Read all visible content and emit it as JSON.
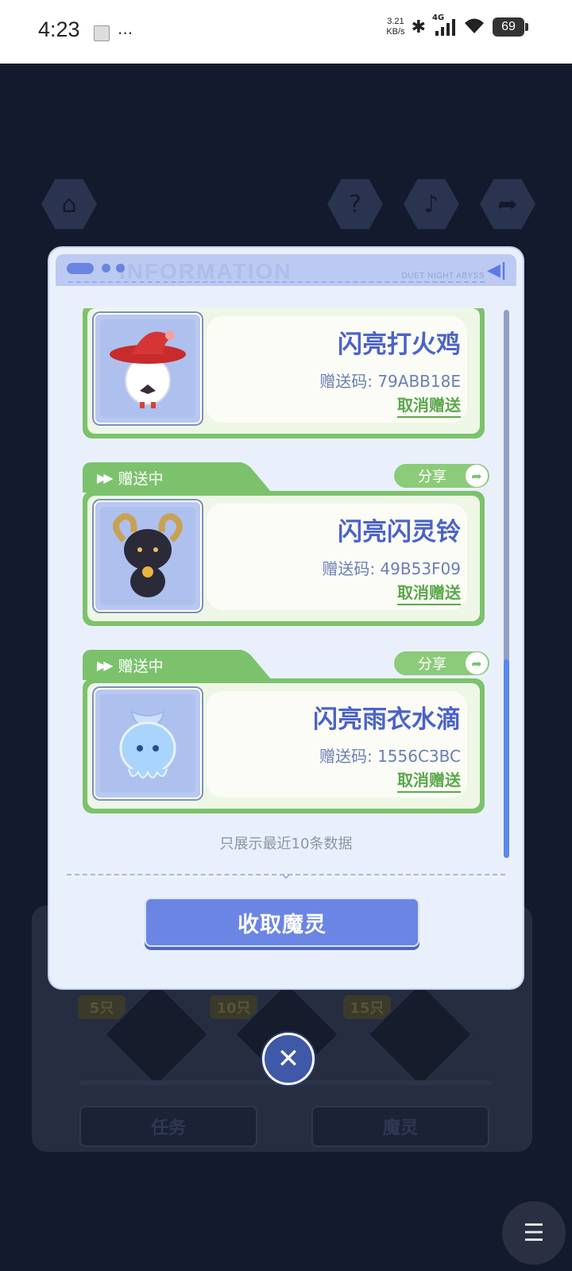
{
  "status_bar": {
    "time": "4:23",
    "network_speed_value": "3.21",
    "network_speed_unit": "KB/s",
    "signal_label": "4G",
    "battery": "69"
  },
  "background": {
    "tabs": [
      "任务",
      "魔灵"
    ],
    "milestones": [
      "5只",
      "10只",
      "15只"
    ]
  },
  "dialog": {
    "header_brand": "DUET NIGHT ABYSS",
    "header_watermark": "INFORMATION",
    "items": [
      {
        "name": "闪亮打火鸡",
        "code": "赠送码: 79ABB18E",
        "cancel_label": "取消赠送"
      },
      {
        "status": "赠送中",
        "share_label": "分享",
        "name": "闪亮闪灵铃",
        "code": "赠送码: 49B53F09",
        "cancel_label": "取消赠送"
      },
      {
        "status": "赠送中",
        "share_label": "分享",
        "name": "闪亮雨衣水滴",
        "code": "赠送码: 1556C3BC",
        "cancel_label": "取消赠送"
      }
    ],
    "footer_note": "只展示最近10条数据",
    "collect_button": "收取魔灵"
  },
  "colors": {
    "accent_blue": "#6a85e4",
    "card_green": "#7cc26c",
    "name_blue": "#4b63c8"
  },
  "icons": [
    "home-icon",
    "help-icon",
    "music-icon",
    "share-icon",
    "close-icon",
    "menu-icon"
  ]
}
